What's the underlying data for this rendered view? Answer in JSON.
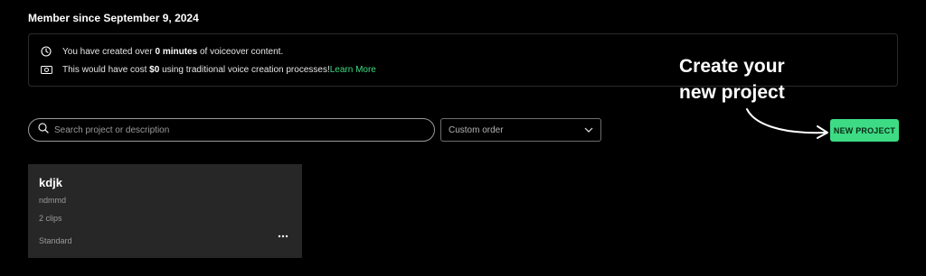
{
  "header": {
    "member_since": "Member since September 9, 2024"
  },
  "info": {
    "row1": {
      "prefix": "You have created over ",
      "amount": "0 minutes",
      "suffix": " of voiceover content.",
      "icon": "clock-icon"
    },
    "row2": {
      "prefix": "This would have cost ",
      "amount": "$0",
      "suffix": " using traditional voice creation processes!",
      "link": "Learn More",
      "icon": "money-icon"
    }
  },
  "toolbar": {
    "search_placeholder": "Search project or description",
    "sort_value": "Custom order",
    "new_project_label": "NEW PROJECT"
  },
  "annotation": {
    "text": "Create your\nnew project"
  },
  "projects": [
    {
      "title": "kdjk",
      "description": "ndmmd",
      "clips": "2 clips",
      "tier": "Standard"
    }
  ],
  "colors": {
    "accent": "#3ddc84",
    "background": "#000000",
    "card": "#272727",
    "border": "#2b2b2b"
  }
}
